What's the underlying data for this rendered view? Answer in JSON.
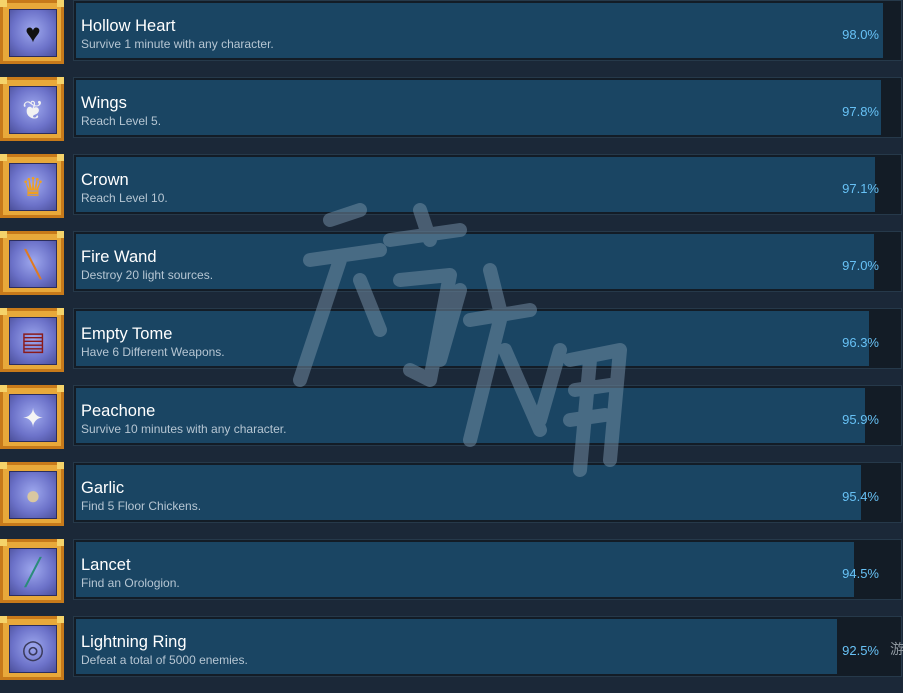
{
  "achievements": [
    {
      "icon": "heart-icon",
      "glyph": "♥",
      "glyph_color": "#111111",
      "title": "Hollow Heart",
      "description": "Survive 1 minute with any character.",
      "percent_label": "98.0%",
      "percent": 98.0
    },
    {
      "icon": "wings-icon",
      "glyph": "❦",
      "glyph_color": "#f2f2f2",
      "title": "Wings",
      "description": "Reach Level 5.",
      "percent_label": "97.8%",
      "percent": 97.8
    },
    {
      "icon": "crown-icon",
      "glyph": "♛",
      "glyph_color": "#f0a020",
      "title": "Crown",
      "description": "Reach Level 10.",
      "percent_label": "97.1%",
      "percent": 97.1
    },
    {
      "icon": "fire-wand-icon",
      "glyph": "╲",
      "glyph_color": "#e07a20",
      "title": "Fire Wand",
      "description": "Destroy 20 light sources.",
      "percent_label": "97.0%",
      "percent": 97.0
    },
    {
      "icon": "book-icon",
      "glyph": "▤",
      "glyph_color": "#8a1a1a",
      "title": "Empty Tome",
      "description": "Have 6 Different Weapons.",
      "percent_label": "96.3%",
      "percent": 96.3
    },
    {
      "icon": "bird-icon",
      "glyph": "✦",
      "glyph_color": "#f4f4f4",
      "title": "Peachone",
      "description": "Survive 10 minutes with any character.",
      "percent_label": "95.9%",
      "percent": 95.9
    },
    {
      "icon": "garlic-icon",
      "glyph": "●",
      "glyph_color": "#d9c7a0",
      "title": "Garlic",
      "description": "Find 5 Floor Chickens.",
      "percent_label": "95.4%",
      "percent": 95.4
    },
    {
      "icon": "lancet-icon",
      "glyph": "╱",
      "glyph_color": "#2a8c7a",
      "title": "Lancet",
      "description": "Find an Orologion.",
      "percent_label": "94.5%",
      "percent": 94.5
    },
    {
      "icon": "ring-icon",
      "glyph": "◎",
      "glyph_color": "#3a3a5a",
      "title": "Lightning Ring",
      "description": "Defeat a total of 5000 enemies.",
      "percent_label": "92.5%",
      "percent": 92.5
    }
  ],
  "watermark": "游侠网",
  "edge_text": "游"
}
